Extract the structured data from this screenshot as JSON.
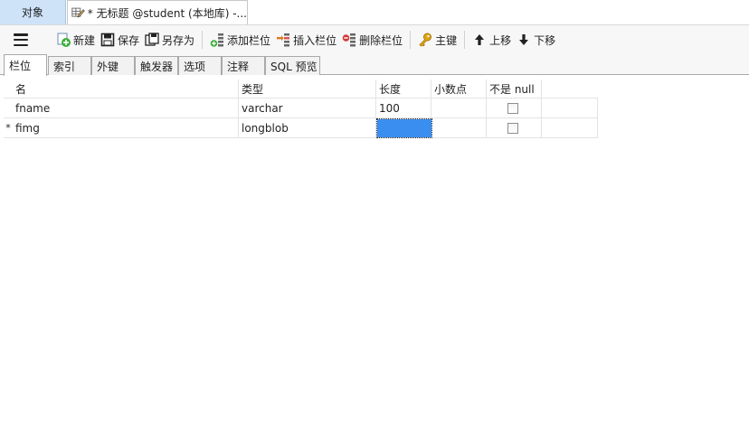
{
  "top_tabs": {
    "objects_label": "对象",
    "editor_label": "* 无标题 @student (本地库) -..."
  },
  "toolbar": {
    "new_label": "新建",
    "save_label": "保存",
    "save_as_label": "另存为",
    "add_field_label": "添加栏位",
    "insert_field_label": "插入栏位",
    "delete_field_label": "删除栏位",
    "primary_key_label": "主键",
    "move_up_label": "上移",
    "move_down_label": "下移"
  },
  "sub_tabs": {
    "fields": "栏位",
    "indexes": "索引",
    "foreign_keys": "外键",
    "triggers": "触发器",
    "options": "选项",
    "comments": "注释",
    "sql_preview": "SQL 预览"
  },
  "grid": {
    "columns": [
      "名",
      "类型",
      "长度",
      "小数点",
      "不是 null"
    ],
    "rows": [
      {
        "marker": "",
        "name": "fname",
        "type": "varchar",
        "length": "100",
        "decimals": "",
        "not_null": false
      },
      {
        "marker": "*",
        "name": "fimg",
        "type": "longblob",
        "length": "",
        "decimals": "",
        "not_null": false
      }
    ]
  },
  "colors": {
    "active_top_tab": "#cfe3f8",
    "selection": "#3a8ef0",
    "new_icon": "#3cae3c",
    "delete_icon": "#d23b3b",
    "key_icon": "#e0a81a"
  }
}
